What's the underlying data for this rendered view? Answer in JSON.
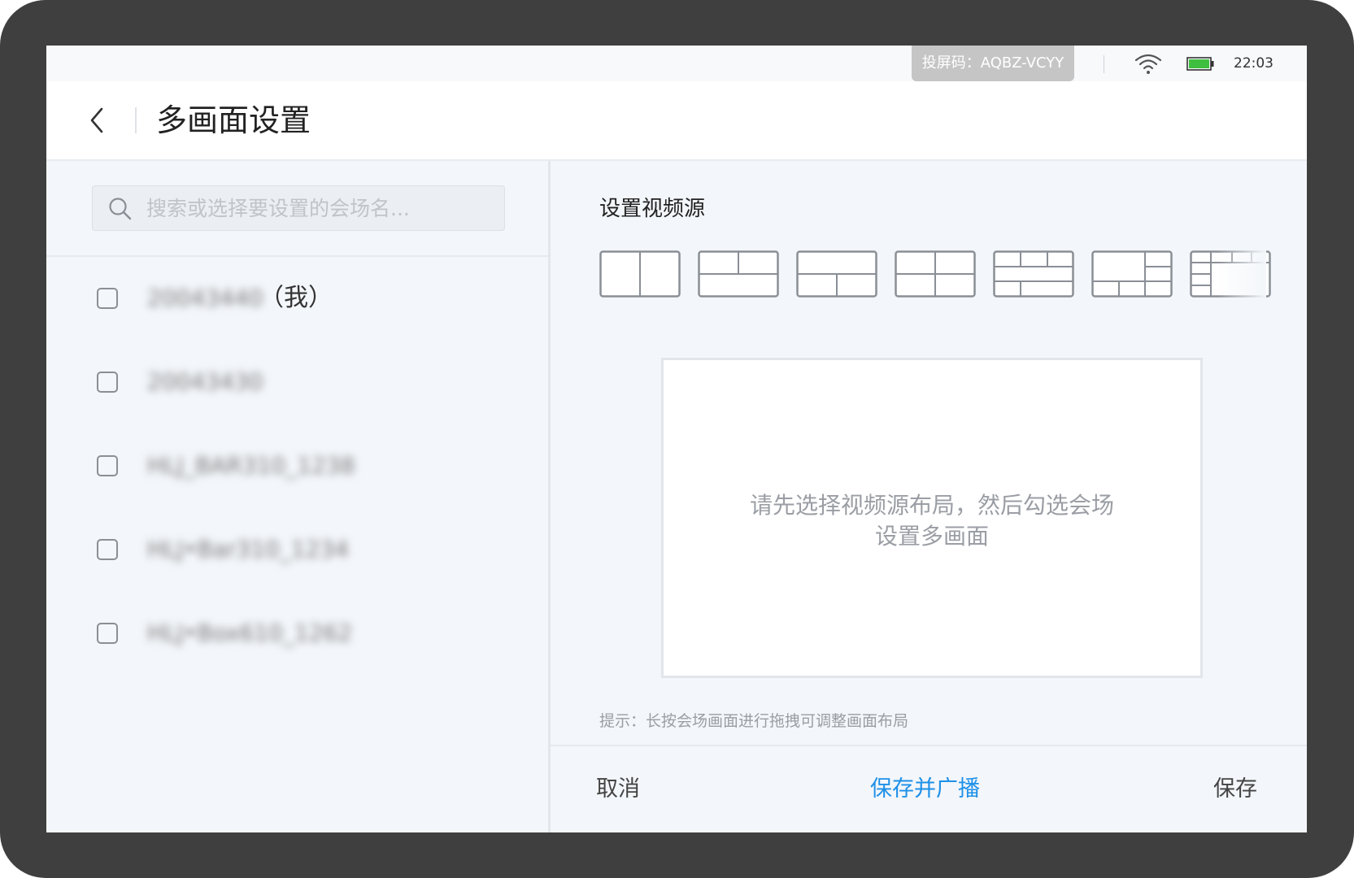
{
  "statusbar": {
    "cast_code": "投屏码：AQBZ-VCYY",
    "time": "22:03",
    "battery_color": "#3fbf3f"
  },
  "header": {
    "title": "多画面设置"
  },
  "search": {
    "placeholder": "搜索或选择要设置的会场名..."
  },
  "venues": [
    {
      "name": "20043440",
      "suffix": "（我）",
      "checked": false
    },
    {
      "name": "20043430",
      "suffix": "",
      "checked": false
    },
    {
      "name": "HLJ_BAR310_1238",
      "suffix": "",
      "checked": false
    },
    {
      "name": "HLJ•Bar310_1234",
      "suffix": "",
      "checked": false
    },
    {
      "name": "HLJ•Box610_1262",
      "suffix": "",
      "checked": false
    }
  ],
  "main": {
    "section_title": "设置视频源",
    "preview_message_line1": "请先选择视频源布局，然后勾选会场",
    "preview_message_line2": "设置多画面",
    "hint": "提示：长按会场画面进行拖拽可调整画面布局"
  },
  "footer": {
    "cancel": "取消",
    "save_broadcast": "保存并广播",
    "save": "保存"
  },
  "colors": {
    "accent": "#1e90e8"
  }
}
